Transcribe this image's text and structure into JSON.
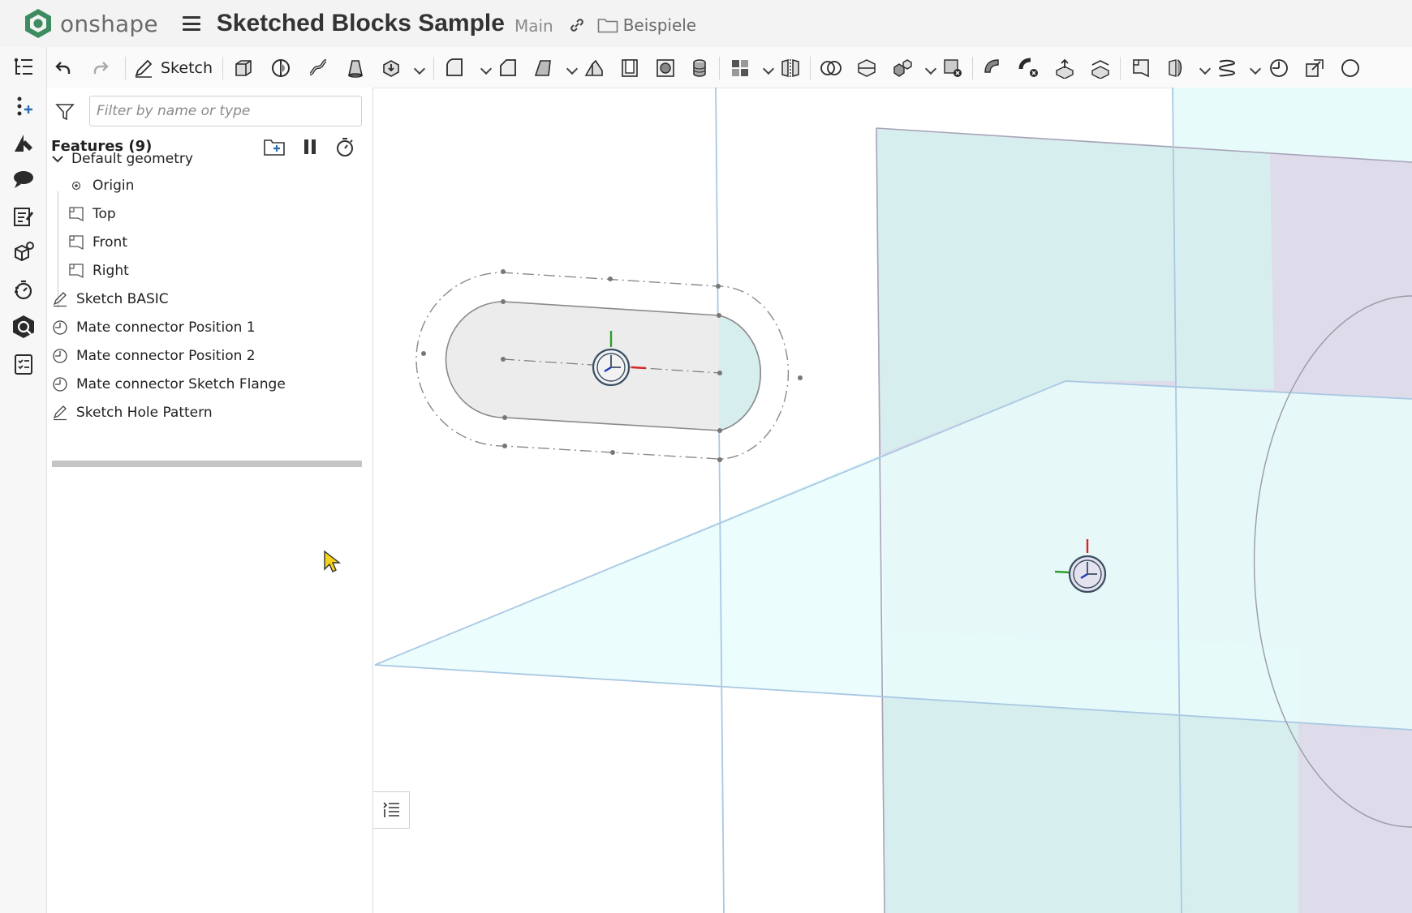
{
  "app": {
    "name": "onshape"
  },
  "document": {
    "title": "Sketched Blocks Sample",
    "branch": "Main",
    "folder": "Beispiele"
  },
  "toolbar": {
    "sketch_label": "Sketch"
  },
  "panel": {
    "filter_placeholder": "Filter by name or type",
    "features_header": "Features (9)",
    "default_geometry": "Default geometry",
    "items": [
      {
        "label": "Origin",
        "icon": "origin-icon"
      },
      {
        "label": "Top",
        "icon": "plane-icon"
      },
      {
        "label": "Front",
        "icon": "plane-icon"
      },
      {
        "label": "Right",
        "icon": "plane-icon"
      },
      {
        "label": "Sketch BASIC",
        "icon": "sketch-icon"
      },
      {
        "label": "Mate connector Position 1",
        "icon": "mate-connector-icon"
      },
      {
        "label": "Mate connector Position 2",
        "icon": "mate-connector-icon"
      },
      {
        "label": "Mate connector Sketch Flange",
        "icon": "mate-connector-icon"
      },
      {
        "label": "Sketch Hole Pattern",
        "icon": "sketch-icon"
      }
    ]
  },
  "colors": {
    "accent": "#2f7d5b",
    "plane_cyan": "#d8f2f1",
    "plane_lavender": "#dedbea",
    "axis_blue": "#a9c8e4",
    "connector_dark": "#3b4f63"
  }
}
